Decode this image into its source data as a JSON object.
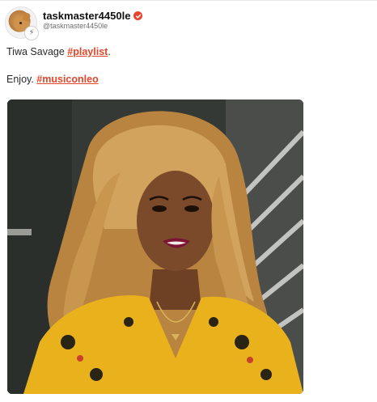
{
  "post": {
    "author": {
      "username": "taskmaster4450le",
      "handle": "@taskmaster4450le",
      "verified": true,
      "avatar_icon": "lion-avatar-icon",
      "badge_icon": "lightning-icon"
    },
    "body": {
      "line1_text": "Tiwa Savage ",
      "line1_hashtag": "#playlist",
      "line1_suffix": ".",
      "line2_text": "Enjoy. ",
      "line2_hashtag": "#musiconleo"
    },
    "image": {
      "subject": "portrait-photo",
      "colors": {
        "hair": "#c8964f",
        "dress": "#e9b21c",
        "lips": "#7b1632",
        "skin": "#7a4a2b"
      }
    }
  },
  "colors": {
    "accent": "#e0472b",
    "verified": "#e8452c",
    "text": "#2a2a2a",
    "muted": "#6f6f6f"
  }
}
